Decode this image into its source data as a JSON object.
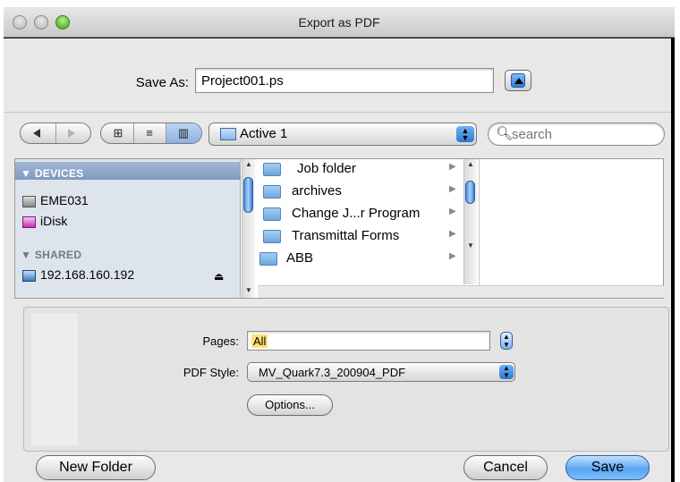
{
  "window": {
    "title": "Export as PDF"
  },
  "save_as": {
    "label": "Save As:",
    "filename": "Project001.ps"
  },
  "toolbar": {
    "view_icons": [
      "grid-icon",
      "list-icon",
      "columns-icon"
    ],
    "location": "Active 1",
    "search_placeholder": "search"
  },
  "sidebar": {
    "devices_header": "DEVICES",
    "devices": [
      {
        "label": "EME031",
        "icon": "hard-drive-icon"
      },
      {
        "label": "iDisk",
        "icon": "idisk-icon"
      }
    ],
    "shared_header": "SHARED",
    "shared": [
      {
        "label": "192.168.160.192",
        "icon": "network-computer-icon"
      }
    ]
  },
  "files": [
    {
      "name": "Job folder"
    },
    {
      "name": "archives"
    },
    {
      "name": "Change J...r Program"
    },
    {
      "name": "Transmittal Forms"
    },
    {
      "name": "ABB"
    }
  ],
  "options": {
    "pages_label": "Pages:",
    "pages_value": "All",
    "pdf_style_label": "PDF Style:",
    "pdf_style_value": "MV_Quark7.3_200904_PDF",
    "options_button": "Options..."
  },
  "buttons": {
    "new_folder": "New Folder",
    "cancel": "Cancel",
    "save": "Save"
  }
}
